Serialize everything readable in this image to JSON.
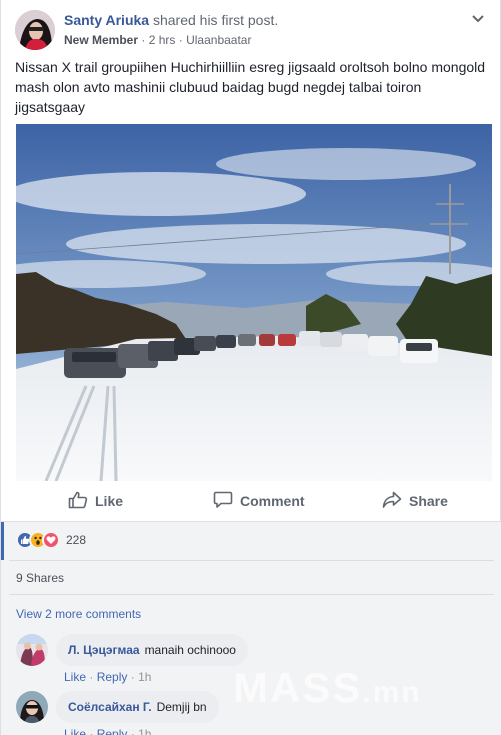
{
  "post": {
    "author_name": "Santy Ariuka",
    "action_text": "shared his first post.",
    "badge": "New Member",
    "time": "2 hrs",
    "location": "Ulaanbaatar",
    "text": "Nissan X trail groupiihen Huchirhiilliin esreg jigsaald oroltsoh bolno mongold mash olon avto mashinii clubuud baidag bugd negdej talbai toiron jigsatsgaay"
  },
  "actions": {
    "like_label": "Like",
    "comment_label": "Comment",
    "share_label": "Share"
  },
  "reactions": {
    "icons": [
      "like-icon",
      "wow-icon",
      "love-icon"
    ],
    "count": "228"
  },
  "shares_text": "9 Shares",
  "more_comments_text": "View 2 more comments",
  "comments": [
    {
      "name": "Л. Цэцэгмаа",
      "text": "manaih ochinooo",
      "like": "Like",
      "reply": "Reply",
      "time": "1h"
    },
    {
      "name": "Соёлсайхан Г.",
      "text": "Demjij bn",
      "like": "Like",
      "reply": "Reply",
      "time": "1h"
    }
  ],
  "watermark": {
    "text": "MASS",
    "suffix": ".mn"
  },
  "colors": {
    "link": "#385898",
    "accent": "#4267b2",
    "like_blue": "#4267b2",
    "love_red": "#f25268",
    "wow_yellow": "#f7b125"
  }
}
